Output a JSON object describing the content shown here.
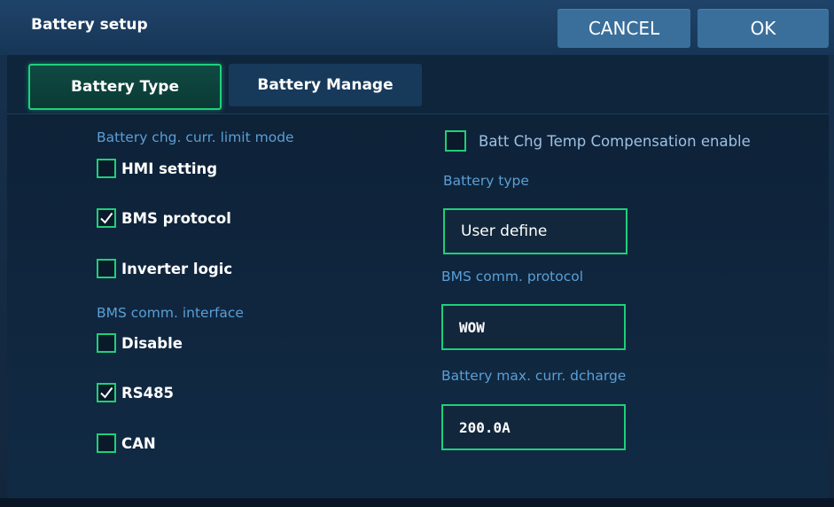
{
  "window": {
    "title": "Battery setup",
    "cancel_label": "CANCEL",
    "ok_label": "OK"
  },
  "tabs": [
    {
      "label": "Battery Type",
      "active": true
    },
    {
      "label": "Battery Manage",
      "active": false
    }
  ],
  "left": {
    "limit_mode": {
      "label": "Battery chg. curr. limit mode",
      "options": [
        {
          "label": "HMI setting",
          "checked": false
        },
        {
          "label": "BMS protocol",
          "checked": true
        },
        {
          "label": "Inverter logic",
          "checked": false
        }
      ]
    },
    "comm_interface": {
      "label": "BMS comm. interface",
      "options": [
        {
          "label": "Disable",
          "checked": false
        },
        {
          "label": "RS485",
          "checked": true
        },
        {
          "label": "CAN",
          "checked": false
        }
      ]
    }
  },
  "right": {
    "temp_comp": {
      "label": "Batt Chg Temp Compensation enable",
      "checked": false
    },
    "battery_type": {
      "label": "Battery type",
      "value": "User define"
    },
    "bms_protocol": {
      "label": "BMS comm. protocol",
      "value": "WOW"
    },
    "max_discharge": {
      "label": "Battery max. curr. dcharge",
      "value": "200.0A"
    }
  },
  "colors": {
    "accent_green": "#1ecf7a",
    "label_blue": "#5b9fd6",
    "button_blue": "#3a6f9b"
  }
}
